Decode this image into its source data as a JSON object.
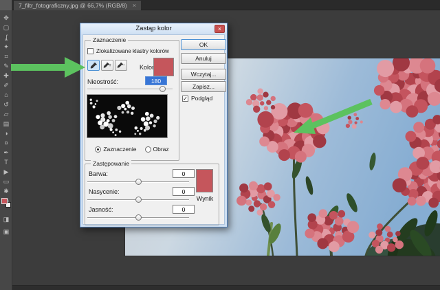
{
  "window": {
    "tab_title": "7_filtr_fotograficzny.jpg @ 66,7% (RGB/8)",
    "tab_close_label": "×"
  },
  "toolbar": {
    "tools": [
      {
        "name": "move-tool-icon",
        "glyph": "✥"
      },
      {
        "name": "marquee-tool-icon",
        "glyph": "▢"
      },
      {
        "name": "lasso-tool-icon",
        "glyph": "ʆ"
      },
      {
        "name": "quick-selection-tool-icon",
        "glyph": "✦"
      },
      {
        "name": "crop-tool-icon",
        "glyph": "⌗"
      },
      {
        "name": "eyedropper-tool-icon",
        "glyph": "✎"
      },
      {
        "name": "healing-brush-tool-icon",
        "glyph": "✚"
      },
      {
        "name": "brush-tool-icon",
        "glyph": "✐"
      },
      {
        "name": "clone-stamp-tool-icon",
        "glyph": "⌂"
      },
      {
        "name": "history-brush-tool-icon",
        "glyph": "↺"
      },
      {
        "name": "eraser-tool-icon",
        "glyph": "▱"
      },
      {
        "name": "gradient-tool-icon",
        "glyph": "▤"
      },
      {
        "name": "blur-tool-icon",
        "glyph": "◑"
      },
      {
        "name": "dodge-tool-icon",
        "glyph": "¤"
      },
      {
        "name": "pen-tool-icon",
        "glyph": "✒"
      },
      {
        "name": "type-tool-icon",
        "glyph": "T"
      },
      {
        "name": "path-selection-tool-icon",
        "glyph": "▶"
      },
      {
        "name": "shape-tool-icon",
        "glyph": "▭"
      },
      {
        "name": "hand-tool-icon",
        "glyph": "✱"
      },
      {
        "name": "zoom-tool-icon",
        "glyph": "◎"
      }
    ],
    "quick_mask_glyph": "◨",
    "screen_mode_glyph": "▣"
  },
  "dialog": {
    "title": "Zastąp kolor",
    "close_label": "×",
    "selection": {
      "legend": "Zaznaczenie",
      "clusters_checkbox": "Zlokalizowane klastry kolorów",
      "color_label": "Kolor:",
      "fuzziness_label": "Nieostrość:",
      "fuzziness_value": "180",
      "radio_selection": "Zaznaczenie",
      "radio_image": "Obraz"
    },
    "replacement": {
      "legend": "Zastępowanie",
      "hue_label": "Barwa:",
      "hue_value": "0",
      "saturation_label": "Nasycenie:",
      "saturation_value": "0",
      "lightness_label": "Jasność:",
      "lightness_value": "0",
      "result_label": "Wynik"
    },
    "buttons": {
      "ok": "OK",
      "cancel": "Anuluj",
      "load": "Wczytaj...",
      "save": "Zapisz...",
      "preview_label": "Podgląd",
      "check_glyph": "✓"
    }
  },
  "colors": {
    "swatch_red": "#c5565c",
    "result_red": "#c5565c",
    "foreground_red": "#c5565c",
    "arrow_green": "#5cc25f",
    "selection_blue": "#3875d6"
  }
}
